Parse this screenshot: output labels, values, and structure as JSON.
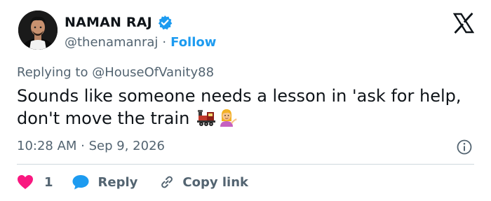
{
  "author": {
    "name": "NAMAN RAJ",
    "handle": "@thenamanraj",
    "separator": "·",
    "follow_label": "Follow",
    "verified": true
  },
  "reply_context": {
    "prefix": "Replying to ",
    "target": "@HouseOfVanity88"
  },
  "tweet": {
    "text": "Sounds like someone needs a lesson in 'ask for help, don't move the train "
  },
  "meta": {
    "time": "10:28 AM",
    "separator": " · ",
    "date": "Sep 9, 2026"
  },
  "actions": {
    "like_count": "1",
    "reply_label": "Reply",
    "copy_label": "Copy link"
  },
  "colors": {
    "accent": "#1d9bf0",
    "text": "#0f1419",
    "secondary": "#536471",
    "like": "#f91880",
    "divider": "#cfd9de"
  },
  "icons": {
    "verified": "verified-badge-icon",
    "logo": "x-logo-icon",
    "info": "info-icon",
    "like": "heart-icon",
    "reply": "speech-bubble-icon",
    "copy": "link-icon",
    "emoji_1": "locomotive-emoji",
    "emoji_2": "person-tipping-hand-emoji"
  }
}
